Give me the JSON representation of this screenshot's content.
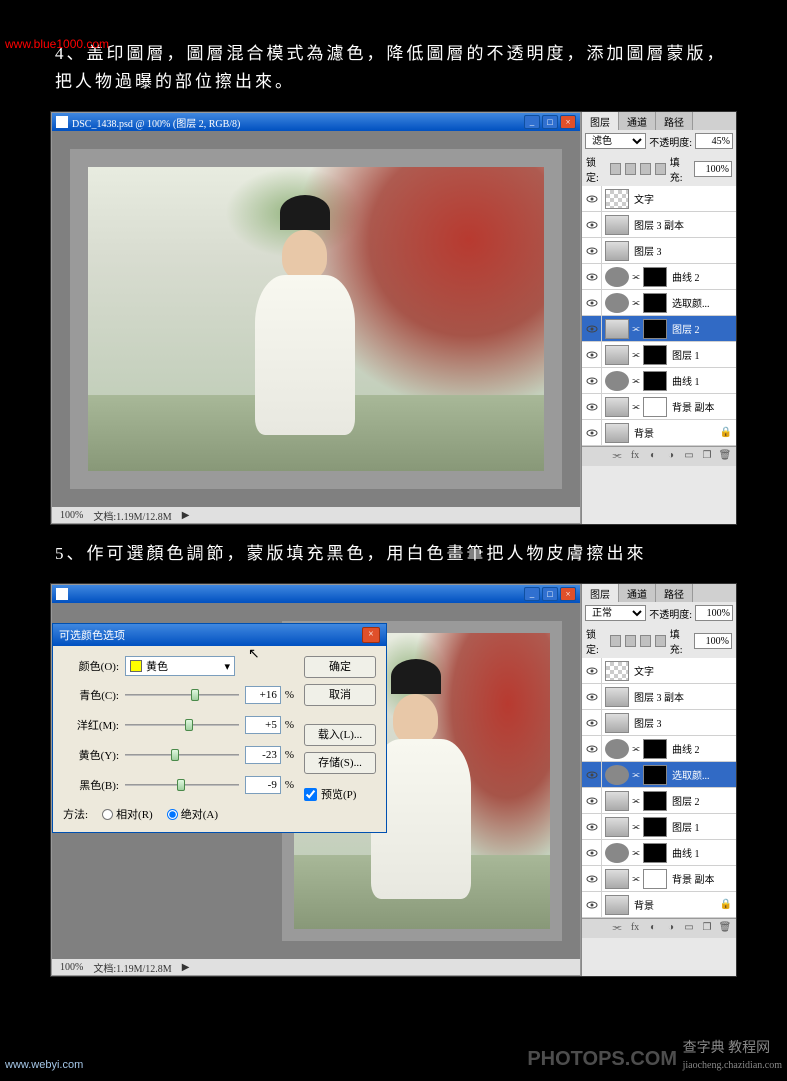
{
  "watermarks": {
    "top": "www.blue1000.com",
    "bottom_left": "www.webyi.com",
    "bottom_mid": "PHOTOPS.COM",
    "bottom_right_main": "查字典 教程网",
    "bottom_right_sub": "jiaocheng.chazidian.com"
  },
  "step4": {
    "text": "4、盖印圖層，圖層混合模式為濾色，降低圖層的不透明度，添加圖層蒙版，把人物過曝的部位擦出來。"
  },
  "step5": {
    "text": "5、作可選顏色調節，蒙版填充黑色，用白色畫筆把人物皮膚擦出來"
  },
  "window1": {
    "title": "DSC_1438.psd @ 100% (图层 2, RGB/8)",
    "zoom": "100%",
    "docsize": "文档:1.19M/12.8M"
  },
  "window2": {
    "title": "",
    "zoom": "100%",
    "docsize": "文档:1.19M/12.8M"
  },
  "layers_panel": {
    "tabs": [
      "图层",
      "通道",
      "路径"
    ],
    "opacity_label": "不透明度:",
    "fill_label": "填充:",
    "lock_label": "锁定:"
  },
  "panel1": {
    "blend": "滤色",
    "opacity": "45%",
    "fill": "100%",
    "layers": [
      {
        "name": "文字",
        "thumb": "checker"
      },
      {
        "name": "图层 3 副本",
        "thumb": "photo"
      },
      {
        "name": "图层 3",
        "thumb": "photo"
      },
      {
        "name": "曲线 2",
        "thumb": "adj",
        "mask": "mask"
      },
      {
        "name": "选取颜...",
        "thumb": "adj",
        "mask": "mask"
      },
      {
        "name": "图层 2",
        "thumb": "photo",
        "mask": "mask",
        "selected": true
      },
      {
        "name": "图层 1",
        "thumb": "photo",
        "mask": "mask"
      },
      {
        "name": "曲线 1",
        "thumb": "adj",
        "mask": "mask"
      },
      {
        "name": "背景 副本",
        "thumb": "photo",
        "mask": "mask-w"
      },
      {
        "name": "背景",
        "thumb": "photo",
        "lock": true
      }
    ]
  },
  "panel2": {
    "blend": "正常",
    "opacity": "100%",
    "fill": "100%",
    "layers": [
      {
        "name": "文字",
        "thumb": "checker"
      },
      {
        "name": "图层 3 副本",
        "thumb": "photo"
      },
      {
        "name": "图层 3",
        "thumb": "photo"
      },
      {
        "name": "曲线 2",
        "thumb": "adj",
        "mask": "mask"
      },
      {
        "name": "选取颜...",
        "thumb": "adj",
        "mask": "mask",
        "selected": true
      },
      {
        "name": "图层 2",
        "thumb": "photo",
        "mask": "mask"
      },
      {
        "name": "图层 1",
        "thumb": "photo",
        "mask": "mask"
      },
      {
        "name": "曲线 1",
        "thumb": "adj",
        "mask": "mask"
      },
      {
        "name": "背景 副本",
        "thumb": "photo",
        "mask": "mask-w"
      },
      {
        "name": "背景",
        "thumb": "photo",
        "lock": true
      }
    ]
  },
  "dialog": {
    "title": "可选颜色选项",
    "color_label": "颜色(O):",
    "color_value": "黄色",
    "sliders": [
      {
        "label": "青色(C):",
        "value": "+16",
        "pos": 58
      },
      {
        "label": "洋红(M):",
        "value": "+5",
        "pos": 53
      },
      {
        "label": "黄色(Y):",
        "value": "-23",
        "pos": 40
      },
      {
        "label": "黑色(B):",
        "value": "-9",
        "pos": 46
      }
    ],
    "method_label": "方法:",
    "relative": "相对(R)",
    "absolute": "绝对(A)",
    "ok": "确定",
    "cancel": "取消",
    "load": "载入(L)...",
    "save": "存储(S)...",
    "preview": "预览(P)"
  }
}
